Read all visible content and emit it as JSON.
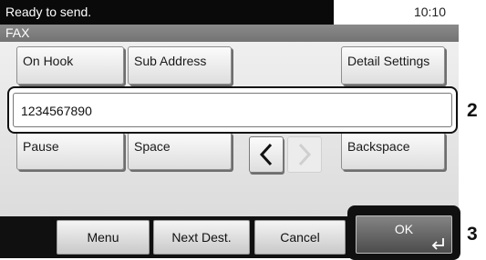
{
  "status": {
    "message": "Ready to send.",
    "time": "10:10"
  },
  "mode": {
    "label": "FAX"
  },
  "top_keys": {
    "on_hook": "On Hook",
    "sub_address": "Sub Address",
    "detail_settings": "Detail Settings"
  },
  "destination": {
    "value": "1234567890"
  },
  "edit_keys": {
    "pause": "Pause",
    "space": "Space",
    "backspace": "Backspace"
  },
  "bottom_keys": {
    "menu": "Menu",
    "next_dest": "Next Dest.",
    "cancel": "Cancel",
    "ok": "OK"
  },
  "callouts": {
    "dest": "2",
    "ok": "3"
  },
  "icons": {
    "left": "chevron-left-icon",
    "right": "chevron-right-icon",
    "enter": "enter-return-icon"
  },
  "colors": {
    "status_bg": "#0a0a0a",
    "bottom_bar_bg": "#101010",
    "ok_key_bg": "#6a6a6a"
  }
}
